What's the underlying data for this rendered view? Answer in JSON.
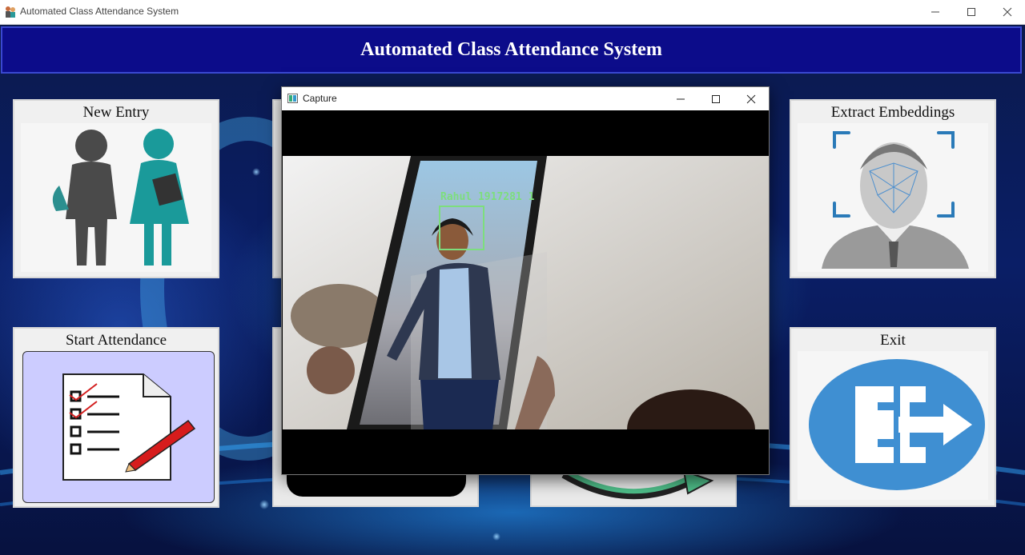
{
  "window": {
    "title": "Automated Class Attendance System",
    "controls": {
      "minimize": "─",
      "maximize": "☐",
      "close": "✕"
    }
  },
  "header": {
    "title": "Automated Class Attendance System"
  },
  "tiles": {
    "new_entry": "New Entry",
    "extract_embeddings": "Extract Embeddings",
    "start_attendance": "Start Attendance",
    "exit": "Exit"
  },
  "capture": {
    "title": "Capture",
    "controls": {
      "minimize": "─",
      "maximize": "☐",
      "close": "✕"
    },
    "detection_label": "Rahul 1917281 1"
  },
  "colors": {
    "header_bg": "#0c0c8a",
    "detect_green": "#7dde7d",
    "exit_blue": "#3f8fd2"
  }
}
